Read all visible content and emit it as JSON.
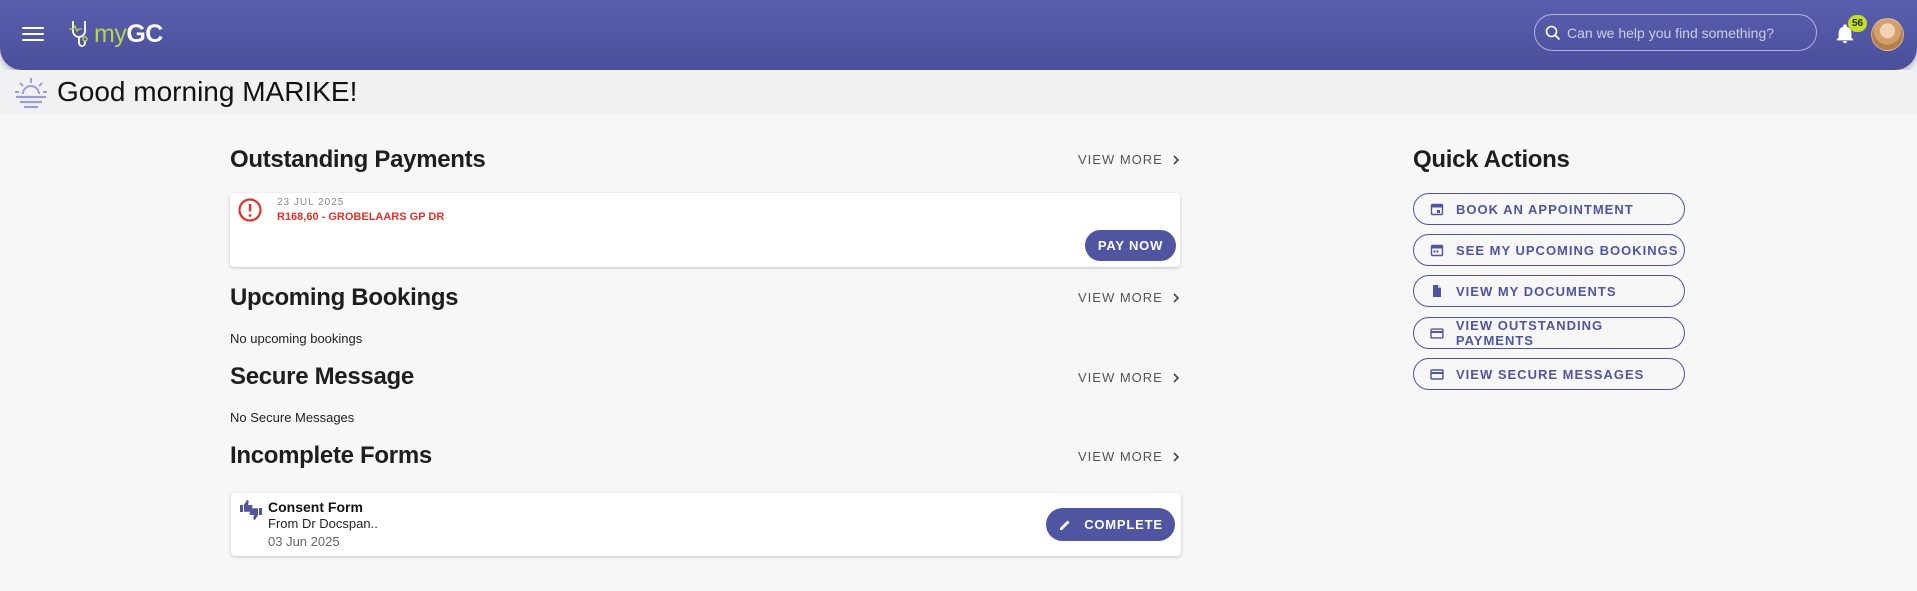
{
  "header": {
    "logo_my": "my",
    "logo_gc": "GC",
    "search_placeholder": "Can we help you find something?",
    "notification_count": "56"
  },
  "greeting": "Good morning MARIKE!",
  "view_more_label": "VIEW MORE",
  "outstanding_payments": {
    "title": "Outstanding Payments",
    "items": [
      {
        "date": "23 JUL 2025",
        "amount": "R168,60 - GROBELAARS GP DR",
        "action": "PAY NOW"
      }
    ]
  },
  "upcoming_bookings": {
    "title": "Upcoming Bookings",
    "empty_text": "No upcoming bookings"
  },
  "secure_message": {
    "title": "Secure Message",
    "empty_text": "No Secure Messages"
  },
  "incomplete_forms": {
    "title": "Incomplete Forms",
    "items": [
      {
        "title": "Consent Form",
        "from": "From Dr Docspan..",
        "date": "03 Jun 2025",
        "action": "COMPLETE"
      }
    ]
  },
  "quick_actions": {
    "title": "Quick Actions",
    "items": [
      {
        "label": "BOOK AN APPOINTMENT",
        "icon": "calendar-plus-icon"
      },
      {
        "label": "SEE MY UPCOMING BOOKINGS",
        "icon": "calendar-icon"
      },
      {
        "label": "VIEW MY DOCUMENTS",
        "icon": "document-icon"
      },
      {
        "label": "VIEW OUTSTANDING PAYMENTS",
        "icon": "credit-card-icon"
      },
      {
        "label": "VIEW SECURE MESSAGES",
        "icon": "credit-card-icon"
      }
    ]
  },
  "colors": {
    "primary": "#4f55a0",
    "header": "#5a5fad",
    "logo_accent": "#b8d44a",
    "badge": "#c6dc2b",
    "alert": "#e0342b"
  }
}
